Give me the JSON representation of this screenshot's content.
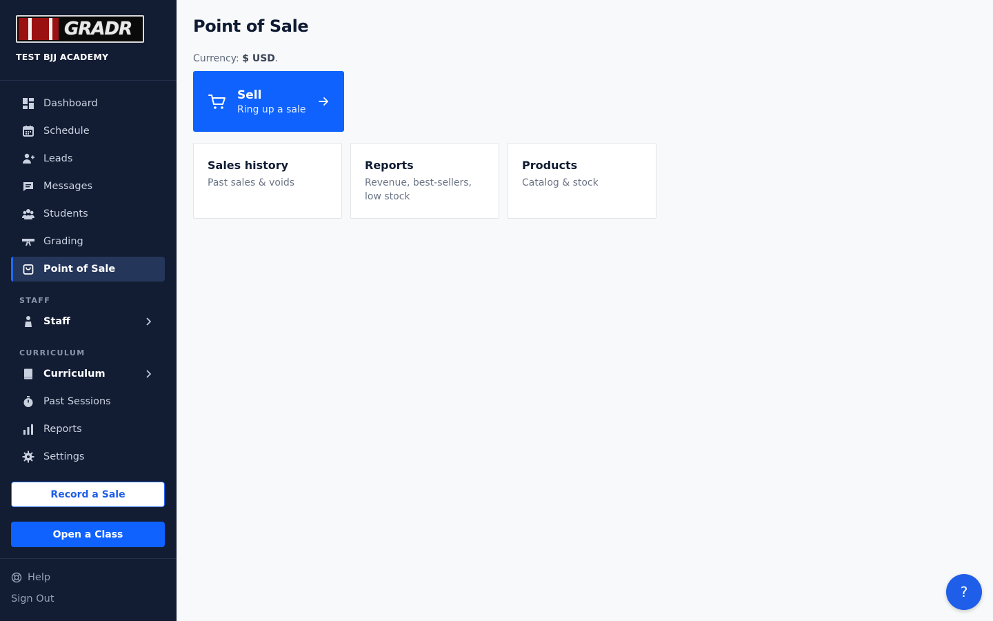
{
  "sidebar": {
    "logo_text": "GRADR",
    "academy_name": "TEST BJJ ACADEMY",
    "items": [
      {
        "label": "Dashboard",
        "icon": "dashboard-icon"
      },
      {
        "label": "Schedule",
        "icon": "calendar-icon"
      },
      {
        "label": "Leads",
        "icon": "user-plus-icon"
      },
      {
        "label": "Messages",
        "icon": "chat-icon"
      },
      {
        "label": "Students",
        "icon": "users-icon"
      },
      {
        "label": "Grading",
        "icon": "belt-icon"
      },
      {
        "label": "Point of Sale",
        "icon": "shopping-bag-icon",
        "active": true
      }
    ],
    "staff_section": {
      "label": "STAFF",
      "item": {
        "label": "Staff",
        "icon": "person-icon"
      }
    },
    "curriculum_section": {
      "label": "CURRICULUM",
      "items": [
        {
          "label": "Curriculum",
          "icon": "book-icon"
        },
        {
          "label": "Past Sessions",
          "icon": "stopwatch-icon"
        },
        {
          "label": "Reports",
          "icon": "bar-chart-icon"
        },
        {
          "label": "Settings",
          "icon": "gear-icon"
        }
      ]
    },
    "record_sale_label": "Record a Sale",
    "open_class_label": "Open a Class",
    "help_label": "Help",
    "sign_out_label": "Sign Out"
  },
  "main": {
    "title": "Point of Sale",
    "currency_prefix": "Currency: ",
    "currency_value": "$ USD",
    "currency_suffix": ".",
    "sell": {
      "title": "Sell",
      "subtitle": "Ring up a sale"
    },
    "cards": [
      {
        "title": "Sales history",
        "desc": "Past sales & voids"
      },
      {
        "title": "Reports",
        "desc": "Revenue, best-sellers, low stock"
      },
      {
        "title": "Products",
        "desc": "Catalog & stock"
      }
    ]
  },
  "help_fab_label": "?",
  "colors": {
    "sidebar_bg": "#121c33",
    "accent": "#0f62fe",
    "active_bg": "#24365a"
  }
}
